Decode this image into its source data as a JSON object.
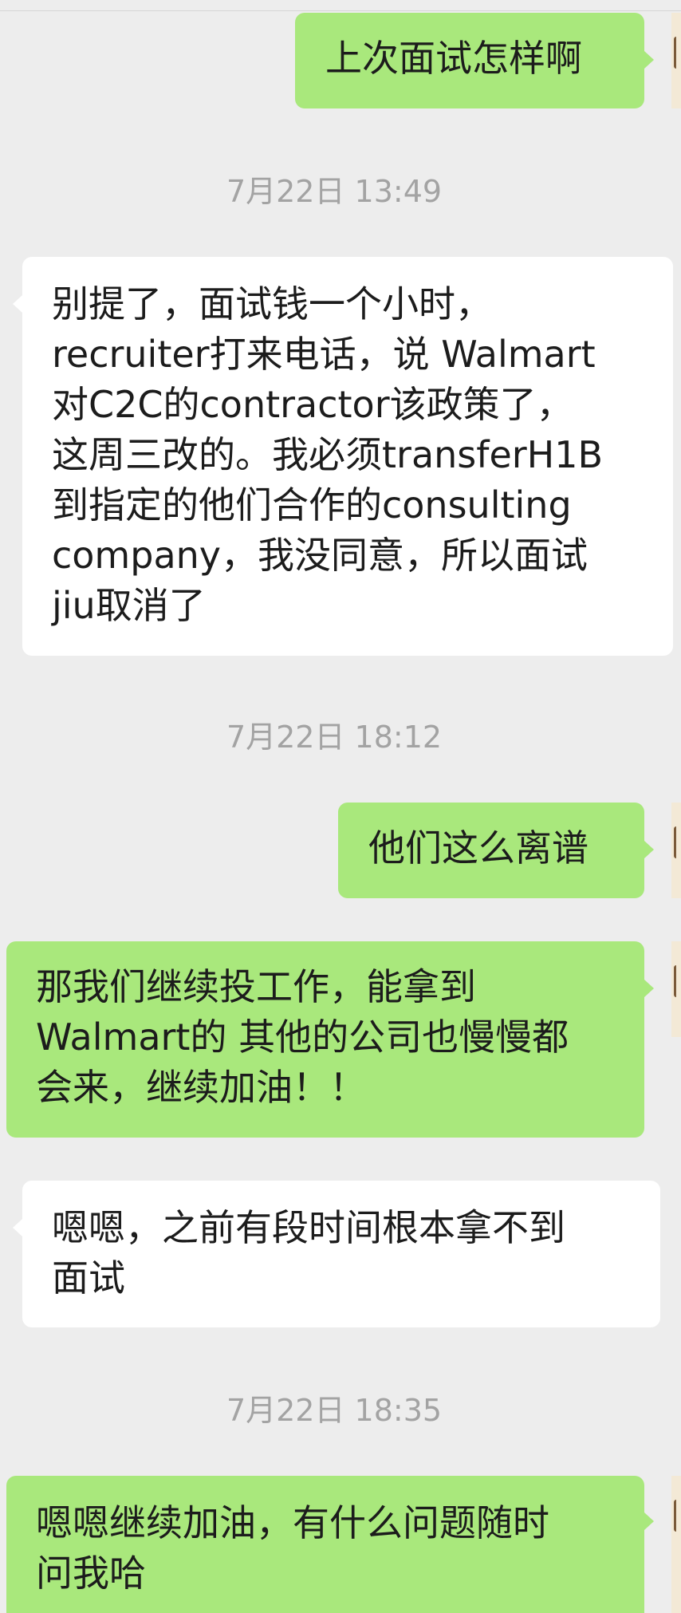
{
  "messages": [
    {
      "type": "sent",
      "text": "上次面试怎样啊"
    },
    {
      "type": "time",
      "text": "7月22日 13:49"
    },
    {
      "type": "recv",
      "text": "别提了，面试钱一个小时，\nrecruiter打来电话，说 Walmart\n对C2C的contractor该政策了，\n这周三改的。我必须transferH1B\n到指定的他们合作的consulting\ncompany，我没同意，所以面试\njiu取消了"
    },
    {
      "type": "time",
      "text": "7月22日 18:12"
    },
    {
      "type": "sent",
      "text": "他们这么离谱"
    },
    {
      "type": "sent",
      "text": "那我们继续投工作，能拿到\nWalmart的 其他的公司也慢慢都\n会来，继续加油！！"
    },
    {
      "type": "recv",
      "text": "嗯嗯，之前有段时间根本拿不到\n面试"
    },
    {
      "type": "time",
      "text": "7月22日 18:35"
    },
    {
      "type": "sent",
      "text": "嗯嗯继续加油，有什么问题随时\n问我哈"
    }
  ],
  "colors": {
    "background": "#ededed",
    "sent_bubble": "#a9e87c",
    "received_bubble": "#ffffff",
    "timestamp_text": "#a3a3a3"
  }
}
